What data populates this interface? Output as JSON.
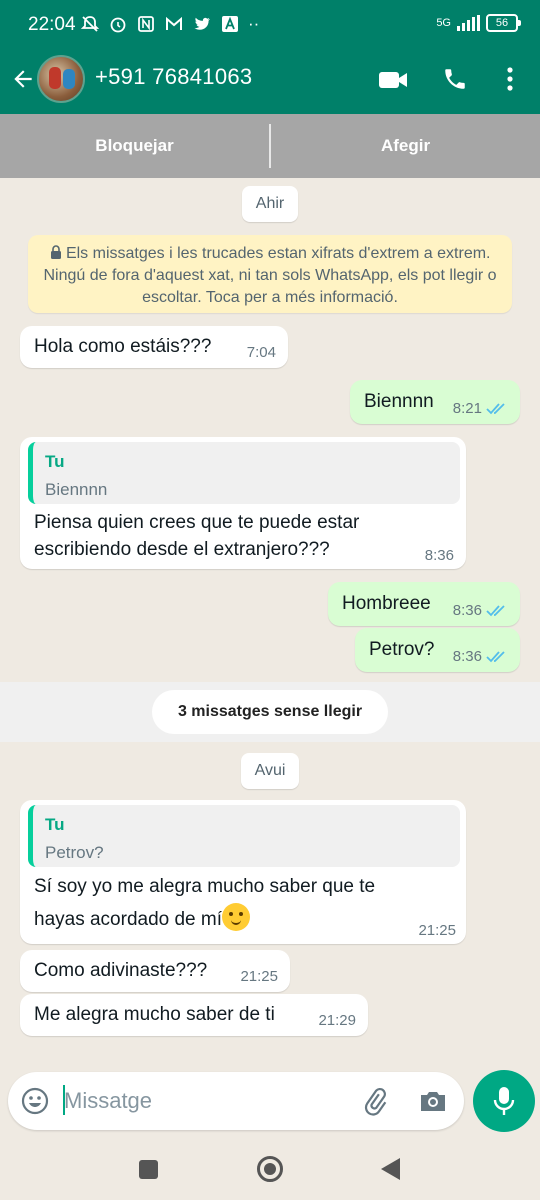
{
  "status_bar": {
    "time": "22:04",
    "network": "5G",
    "battery": "56"
  },
  "header": {
    "contact_name": "+591 76841063"
  },
  "block_bar": {
    "block_label": "Bloquejar",
    "add_label": "Afegir"
  },
  "chat": {
    "date_yesterday": "Ahir",
    "encryption_notice": "Els missatges i les trucades estan xifrats d'extrem a extrem. Ningú de fora d'aquest xat, ni tan sols WhatsApp, els pot llegir o escoltar. Toca per a més informació.",
    "unread_label": "3 missatges sense llegir",
    "date_today": "Avui",
    "messages": [
      {
        "direction": "in",
        "text": "Hola como estáis???",
        "time": "7:04"
      },
      {
        "direction": "out",
        "text": "Biennnn",
        "time": "8:21",
        "status": "read"
      },
      {
        "direction": "in",
        "quote_name": "Tu",
        "quote_text": "Biennnn",
        "text_line1": "Piensa quien crees que te puede estar",
        "text_line2": "escribiendo desde el extranjero???",
        "time": "8:36"
      },
      {
        "direction": "out",
        "text": "Hombreee",
        "time": "8:36",
        "status": "read"
      },
      {
        "direction": "out",
        "text": "Petrov?",
        "time": "8:36",
        "status": "read"
      },
      {
        "direction": "in",
        "quote_name": "Tu",
        "quote_text": "Petrov?",
        "text_line1": "Sí soy yo me alegra mucho saber que te",
        "text_line2": "hayas acordado de mí",
        "emoji": "hugging-face",
        "time": "21:25"
      },
      {
        "direction": "in",
        "text": "Como adivinaste???",
        "time": "21:25"
      },
      {
        "direction": "in",
        "text": "Me alegra mucho saber de ti",
        "time": "21:29"
      }
    ]
  },
  "composer": {
    "placeholder": "Missatge"
  },
  "colors": {
    "header_green": "#008069",
    "outgoing_bubble": "#D9FDD3",
    "read_ticks": "#53BDEB",
    "mic_button": "#00A884",
    "encryption_bg": "#FFF3C4"
  },
  "icons": [
    "back-arrow-icon",
    "video-call-icon",
    "phone-icon",
    "more-vert-icon",
    "emoji-icon",
    "attach-icon",
    "camera-icon",
    "mic-icon",
    "lock-icon"
  ]
}
